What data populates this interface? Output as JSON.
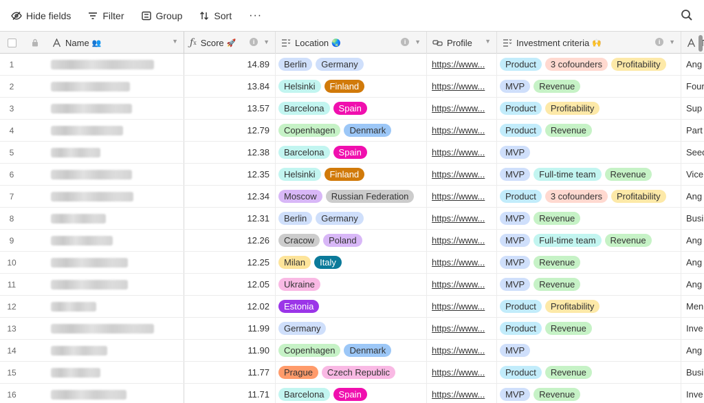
{
  "toolbar": {
    "hide_fields": "Hide fields",
    "filter": "Filter",
    "group": "Group",
    "sort": "Sort",
    "more": "···"
  },
  "columns": {
    "name": {
      "label": "Name",
      "emoji": "👥"
    },
    "score": {
      "label": "Score",
      "emoji": "🚀"
    },
    "location": {
      "label": "Location",
      "emoji": "🌏"
    },
    "profile": {
      "label": "Profile"
    },
    "investment": {
      "label": "Investment criteria",
      "emoji": "🙌"
    },
    "type": {
      "label": "T"
    }
  },
  "tag_colors": {
    "Berlin": "#cfdffb",
    "Germany": "#cfdffb",
    "Helsinki": "#c2f5f0",
    "Finland": "#d17a0a",
    "Barcelona": "#c2f5f0",
    "Spain": "#f00fae",
    "Copenhagen": "#c6f2c6",
    "Denmark": "#9cc7f7",
    "Moscow": "#d8b7f7",
    "Russian Federation": "#cccccc",
    "Cracow": "#cccccc",
    "Poland": "#d8b7f7",
    "Milan": "#fde49a",
    "Italy": "#0b7a9a",
    "Ukraine": "#f9b9e4",
    "Estonia": "#9b35e8",
    "Prague": "#ff9b6b",
    "Czech Republic": "#f9b9e4",
    "Product": "#c2ecfb",
    "3 cofounders": "#ffd9d0",
    "Profitability": "#fde9a8",
    "MVP": "#cfdffb",
    "Revenue": "#c6f2c6",
    "Full-time team": "#c2f5f0"
  },
  "dark_tags": [
    "Finland",
    "Spain",
    "Italy",
    "Estonia"
  ],
  "rows": [
    {
      "num": "1",
      "score": "14.89",
      "location": [
        "Berlin",
        "Germany"
      ],
      "profile": "https://www...",
      "investment": [
        "Product",
        "3 cofounders",
        "Profitability"
      ],
      "type": "Ang"
    },
    {
      "num": "2",
      "score": "13.84",
      "location": [
        "Helsinki",
        "Finland"
      ],
      "profile": "https://www...",
      "investment": [
        "MVP",
        "Revenue"
      ],
      "type": "Four"
    },
    {
      "num": "3",
      "score": "13.57",
      "location": [
        "Barcelona",
        "Spain"
      ],
      "profile": "https://www...",
      "investment": [
        "Product",
        "Profitability"
      ],
      "type": "Sup"
    },
    {
      "num": "4",
      "score": "12.79",
      "location": [
        "Copenhagen",
        "Denmark"
      ],
      "profile": "https://www...",
      "investment": [
        "Product",
        "Revenue"
      ],
      "type": "Part"
    },
    {
      "num": "5",
      "score": "12.38",
      "location": [
        "Barcelona",
        "Spain"
      ],
      "profile": "https://www...",
      "investment": [
        "MVP"
      ],
      "type": "Seed"
    },
    {
      "num": "6",
      "score": "12.35",
      "location": [
        "Helsinki",
        "Finland"
      ],
      "profile": "https://www...",
      "investment": [
        "MVP",
        "Full-time team",
        "Revenue"
      ],
      "type": "Vice"
    },
    {
      "num": "7",
      "score": "12.34",
      "location": [
        "Moscow",
        "Russian Federation"
      ],
      "profile": "https://www...",
      "investment": [
        "Product",
        "3 cofounders",
        "Profitability"
      ],
      "type": "Ang"
    },
    {
      "num": "8",
      "score": "12.31",
      "location": [
        "Berlin",
        "Germany"
      ],
      "profile": "https://www...",
      "investment": [
        "MVP",
        "Revenue"
      ],
      "type": "Busi"
    },
    {
      "num": "9",
      "score": "12.26",
      "location": [
        "Cracow",
        "Poland"
      ],
      "profile": "https://www...",
      "investment": [
        "MVP",
        "Full-time team",
        "Revenue"
      ],
      "type": "Ang"
    },
    {
      "num": "10",
      "score": "12.25",
      "location": [
        "Milan",
        "Italy"
      ],
      "profile": "https://www...",
      "investment": [
        "MVP",
        "Revenue"
      ],
      "type": "Ang"
    },
    {
      "num": "11",
      "score": "12.05",
      "location": [
        "Ukraine"
      ],
      "profile": "https://www...",
      "investment": [
        "MVP",
        "Revenue"
      ],
      "type": "Ang"
    },
    {
      "num": "12",
      "score": "12.02",
      "location": [
        "Estonia"
      ],
      "profile": "https://www...",
      "investment": [
        "Product",
        "Profitability"
      ],
      "type": "Men"
    },
    {
      "num": "13",
      "score": "11.99",
      "location": [
        "Germany"
      ],
      "profile": "https://www...",
      "investment": [
        "Product",
        "Revenue"
      ],
      "type": "Inve"
    },
    {
      "num": "14",
      "score": "11.90",
      "location": [
        "Copenhagen",
        "Denmark"
      ],
      "profile": "https://www...",
      "investment": [
        "MVP"
      ],
      "type": "Ang"
    },
    {
      "num": "15",
      "score": "11.77",
      "location": [
        "Prague",
        "Czech Republic"
      ],
      "profile": "https://www...",
      "investment": [
        "Product",
        "Revenue"
      ],
      "type": "Busi"
    },
    {
      "num": "16",
      "score": "11.71",
      "location": [
        "Barcelona",
        "Spain"
      ],
      "profile": "https://www...",
      "investment": [
        "MVP",
        "Revenue"
      ],
      "type": "Inve"
    }
  ]
}
